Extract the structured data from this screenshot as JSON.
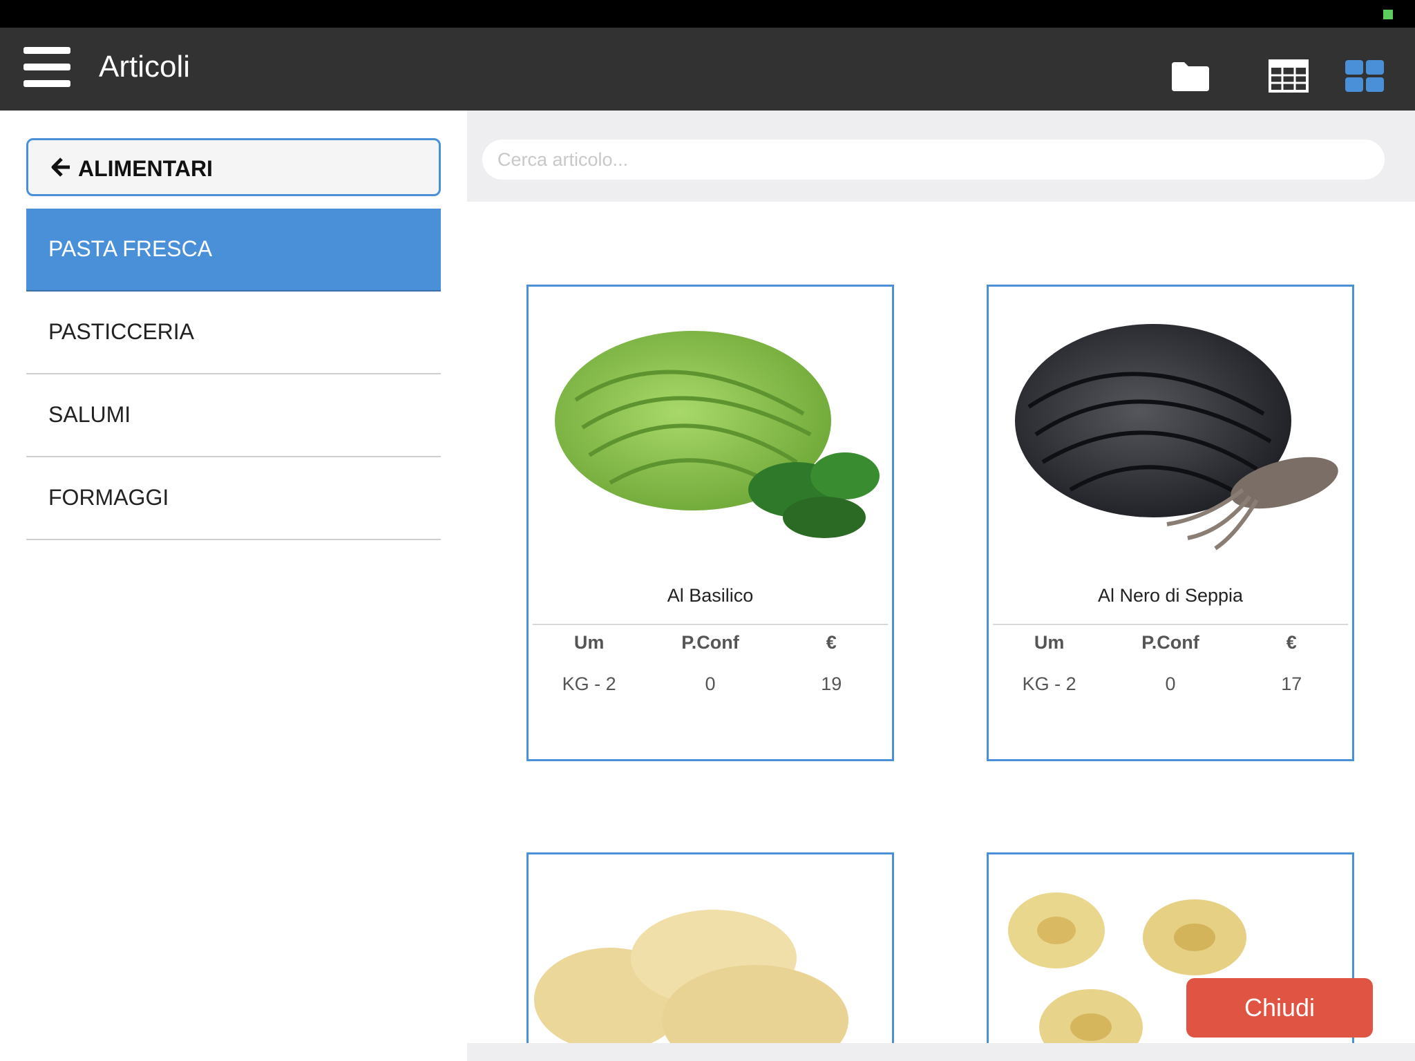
{
  "header": {
    "title": "Articoli"
  },
  "icons": {
    "menu": "hamburger-menu-icon",
    "folder": "folder-icon",
    "table": "table-view-icon",
    "grid": "grid-view-icon",
    "back": "arrow-left-icon"
  },
  "colors": {
    "accent": "#4a90d9",
    "header_bg": "#323232",
    "close": "#e05444"
  },
  "sidebar": {
    "back_label": "ALIMENTARI",
    "items": [
      {
        "label": "PASTA FRESCA",
        "active": true
      },
      {
        "label": "PASTICCERIA",
        "active": false
      },
      {
        "label": "SALUMI",
        "active": false
      },
      {
        "label": "FORMAGGI",
        "active": false
      }
    ]
  },
  "search": {
    "placeholder": "Cerca articolo..."
  },
  "columns": {
    "um": "Um",
    "pconf": "P.Conf",
    "price": "€"
  },
  "products": [
    {
      "name": "Al Basilico",
      "um": "KG - 2",
      "pconf": "0",
      "price": "19"
    },
    {
      "name": "Al Nero di Seppia",
      "um": "KG - 2",
      "pconf": "0",
      "price": "17"
    }
  ],
  "close_label": "Chiudi"
}
